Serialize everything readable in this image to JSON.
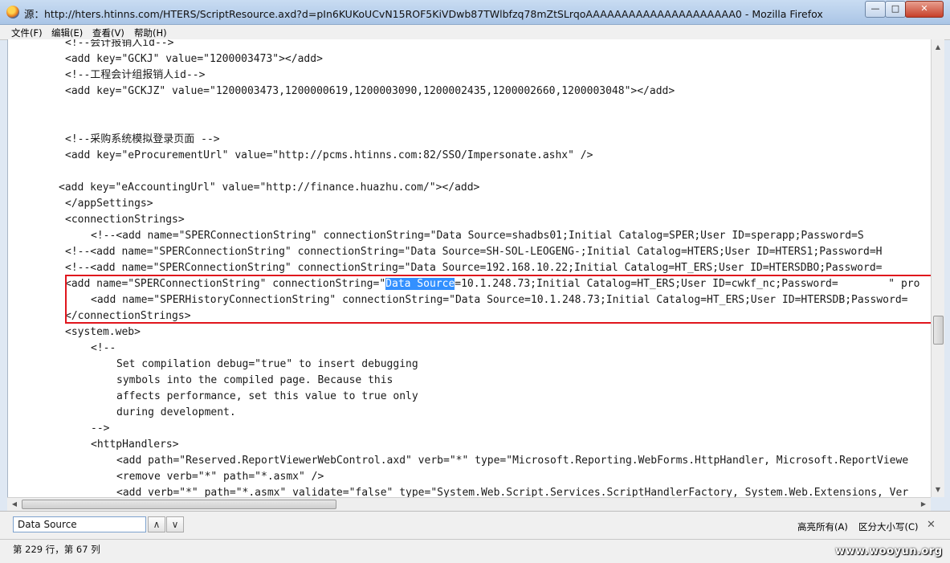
{
  "window": {
    "title": "源：http://hters.htinns.com/HTERS/ScriptResource.axd?d=pIn6KUKoUCvN15ROF5KiVDwb87TWlbfzq78mZtSLrqoAAAAAAAAAAAAAAAAAAAAA0 - Mozilla Firefox",
    "minimize": "—",
    "maximize": "□",
    "close": "✕"
  },
  "menu": {
    "file": "文件(F)",
    "edit": "编辑(E)",
    "view": "查看(V)",
    "help": "帮助(H)"
  },
  "source_lines": [
    {
      "indent": 80,
      "text": "<!--会计报销人id-->"
    },
    {
      "indent": 80,
      "text": "<add key=\"GCKJ\" value=\"1200003473\"></add>"
    },
    {
      "indent": 80,
      "text": "<!--工程会计组报销人id-->"
    },
    {
      "indent": 80,
      "text": "<add key=\"GCKJZ\" value=\"1200003473,1200000619,1200003090,1200002435,1200002660,1200003048\"></add>"
    },
    {
      "indent": 80,
      "text": ""
    },
    {
      "indent": 80,
      "text": ""
    },
    {
      "indent": 80,
      "text": "<!--采购系统模拟登录页面 -->"
    },
    {
      "indent": 80,
      "text": "<add key=\"eProcurementUrl\" value=\"http://pcms.htinns.com:82/SSO/Impersonate.ashx\" />"
    },
    {
      "indent": 80,
      "text": ""
    },
    {
      "indent": 72,
      "text": "<add key=\"eAccountingUrl\" value=\"http://finance.huazhu.com/\"></add>"
    },
    {
      "indent": 80,
      "text": "</appSettings>"
    },
    {
      "indent": 80,
      "text": "<connectionStrings>"
    },
    {
      "indent": 112,
      "text": "<!--<add name=\"SPERConnectionString\" connectionString=\"Data Source=shadbs01;Initial Catalog=SPER;User ID=sperapp;Password=S"
    },
    {
      "indent": 80,
      "text": "<!--<add name=\"SPERConnectionString\" connectionString=\"Data Source=SH-SOL-LEOGENG-;Initial Catalog=HTERS;User ID=HTERS1;Password=H"
    },
    {
      "indent": 80,
      "text": "<!--<add name=\"SPERConnectionString\" connectionString=\"Data Source=192.168.10.22;Initial Catalog=HT_ERS;User ID=HTERSDBO;Password="
    },
    {
      "indent": 80,
      "text": "<add name=\"SPERConnectionString\" connectionString=\"",
      "hl": "Data Source",
      "after": "=10.1.248.73;Initial Catalog=HT_ERS;User ID=cwkf_nc;Password=        \" pro"
    },
    {
      "indent": 112,
      "text": "<add name=\"SPERHistoryConnectionString\" connectionString=\"Data Source=10.1.248.73;Initial Catalog=HT_ERS;User ID=HTERSDB;Password="
    },
    {
      "indent": 80,
      "text": "</connectionStrings>"
    },
    {
      "indent": 80,
      "text": "<system.web>"
    },
    {
      "indent": 112,
      "text": "<!--"
    },
    {
      "indent": 144,
      "text": "Set compilation debug=\"true\" to insert debugging"
    },
    {
      "indent": 144,
      "text": "symbols into the compiled page. Because this"
    },
    {
      "indent": 144,
      "text": "affects performance, set this value to true only"
    },
    {
      "indent": 144,
      "text": "during development."
    },
    {
      "indent": 112,
      "text": "-->"
    },
    {
      "indent": 112,
      "text": "<httpHandlers>"
    },
    {
      "indent": 144,
      "text": "<add path=\"Reserved.ReportViewerWebControl.axd\" verb=\"*\" type=\"Microsoft.Reporting.WebForms.HttpHandler, Microsoft.ReportViewe"
    },
    {
      "indent": 144,
      "text": "<remove verb=\"*\" path=\"*.asmx\" />"
    },
    {
      "indent": 144,
      "text": "<add verb=\"*\" path=\"*.asmx\" validate=\"false\" type=\"System.Web.Script.Services.ScriptHandlerFactory, System.Web.Extensions, Ver"
    }
  ],
  "findbar": {
    "query": "Data Source",
    "prev": "∧",
    "next": "∨",
    "highlight_all": "高亮所有(A)",
    "match_case": "区分大小写(C)",
    "close": "✕"
  },
  "status": {
    "position": "第 229 行，第 67 列"
  },
  "watermark": "www.wooyun.org"
}
